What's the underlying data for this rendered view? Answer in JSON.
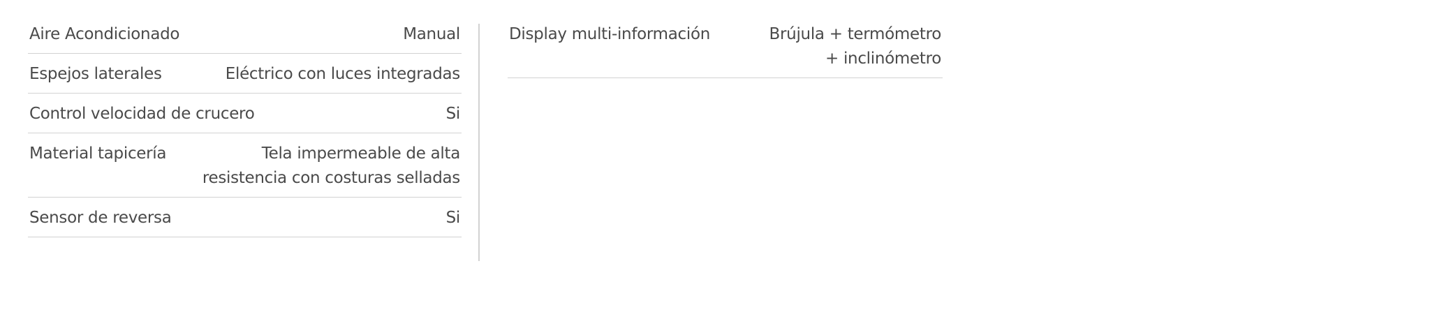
{
  "specs_left": [
    {
      "label": "Aire Acondicionado",
      "value": [
        "Manual"
      ]
    },
    {
      "label": "Espejos laterales",
      "value": [
        "Eléctrico con luces integradas"
      ]
    },
    {
      "label": "Control velocidad de crucero",
      "value": [
        "Si"
      ]
    },
    {
      "label": "Material tapicería",
      "value": [
        "Tela impermeable de alta",
        "resistencia con costuras selladas"
      ]
    },
    {
      "label": "Sensor de reversa",
      "value": [
        "Si"
      ]
    }
  ],
  "specs_right": [
    {
      "label": "Display multi-información",
      "value": [
        "Brújula + termómetro",
        "+ inclinómetro"
      ]
    }
  ]
}
